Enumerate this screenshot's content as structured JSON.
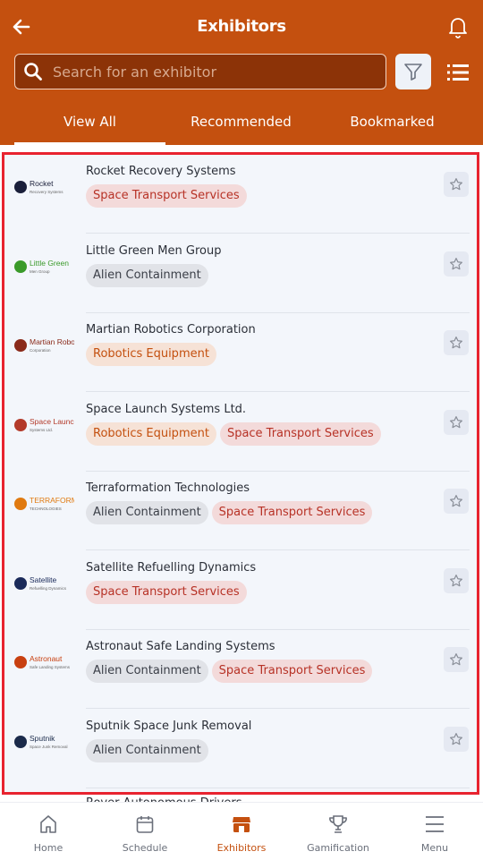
{
  "header": {
    "title": "Exhibitors",
    "back_icon": "arrow-left-icon",
    "bell_icon": "bell-icon"
  },
  "search": {
    "placeholder": "Search for an exhibitor",
    "value": ""
  },
  "tabs": [
    {
      "label": "View All",
      "active": true
    },
    {
      "label": "Recommended",
      "active": false
    },
    {
      "label": "Bookmarked",
      "active": false
    }
  ],
  "exhibitors": [
    {
      "name": "Rocket Recovery Systems",
      "tags": [
        "Space Transport Services"
      ],
      "logo_text": "Rocket",
      "logo_sub": "Recovery Systems"
    },
    {
      "name": "Little Green Men Group",
      "tags": [
        "Alien Containment"
      ],
      "logo_text": "Little Green",
      "logo_sub": "Men Group"
    },
    {
      "name": "Martian Robotics Corporation",
      "tags": [
        "Robotics Equipment"
      ],
      "logo_text": "Martian Robotics",
      "logo_sub": "Corporation"
    },
    {
      "name": "Space Launch Systems Ltd.",
      "tags": [
        "Robotics Equipment",
        "Space Transport Services"
      ],
      "logo_text": "Space Launch",
      "logo_sub": "Systems Ltd."
    },
    {
      "name": "Terraformation Technologies",
      "tags": [
        "Alien Containment",
        "Space Transport Services"
      ],
      "logo_text": "TERRAFORMATION",
      "logo_sub": "TECHNOLOGIES"
    },
    {
      "name": "Satellite Refuelling Dynamics",
      "tags": [
        "Space Transport Services"
      ],
      "logo_text": "Satellite",
      "logo_sub": "Refuelling Dynamics"
    },
    {
      "name": "Astronaut Safe Landing Systems",
      "tags": [
        "Alien Containment",
        "Space Transport Services"
      ],
      "logo_text": "Astronaut",
      "logo_sub": "Safe Landing Systems"
    },
    {
      "name": "Sputnik Space Junk Removal",
      "tags": [
        "Alien Containment"
      ],
      "logo_text": "Sputnik",
      "logo_sub": "Space Junk Removal"
    }
  ],
  "partial_row_name": "Rover Autonomous Drivers",
  "bottom_nav": [
    {
      "label": "Home",
      "icon": "home-icon",
      "active": false
    },
    {
      "label": "Schedule",
      "icon": "calendar-icon",
      "active": false
    },
    {
      "label": "Exhibitors",
      "icon": "store-icon",
      "active": true
    },
    {
      "label": "Gamification",
      "icon": "trophy-icon",
      "active": false
    },
    {
      "label": "Menu",
      "icon": "menu-icon",
      "active": false
    }
  ],
  "colors": {
    "brand": "#c4500f",
    "highlight_border": "#e8232f"
  }
}
